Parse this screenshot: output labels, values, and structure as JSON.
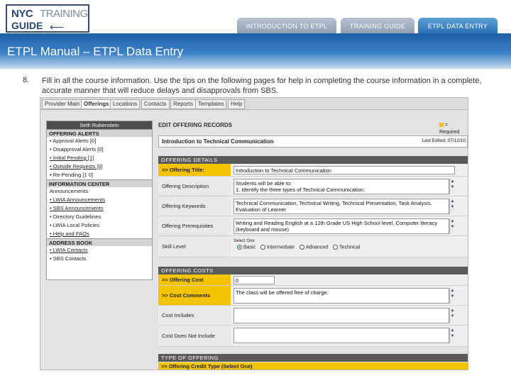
{
  "logo": {
    "nyc": "NYC",
    "training": "TRAINING",
    "guide": "GUIDE"
  },
  "nav": [
    {
      "label": "INTRODUCTION TO ETPL"
    },
    {
      "label": "TRAINING GUIDE"
    },
    {
      "label": "ETPL DATA ENTRY"
    }
  ],
  "page_title": "ETPL Manual – ETPL Data Entry",
  "step": {
    "number": "8.",
    "text": "Fill in all the course information. Use the tips on the following pages for help in completing the course information in a complete, accurate manner that will reduce delays and disapprovals from SBS."
  },
  "screenshot": {
    "tabs": [
      "Provider Main",
      "Offerings",
      "Locations",
      "Contacts",
      "Reports",
      "Templates",
      "Help"
    ],
    "user_name": "Seth Rubenstein",
    "sidebar": {
      "offering_alerts": {
        "heading": "OFFERING ALERTS",
        "items": [
          "• Approval Alerts [0]",
          "• Disapproval Alerts [0]",
          "• Initial Pending [1]",
          "• Outside Requests [0]",
          "• Re-Pending [1 0]"
        ]
      },
      "information_center": {
        "heading": "INFORMATION CENTER",
        "items": [
          "Announcements",
          "• LWIA Announcements",
          "• SBS Announcements",
          "• Directory Guidelines",
          "• LWIA Local Policies",
          "• Help and FAQs"
        ]
      },
      "address_book": {
        "heading": "ADDRESS BOOK",
        "items": [
          "• LWIA Contacts",
          "• SBS Contacts"
        ]
      }
    },
    "edit_heading": "EDIT OFFERING RECORDS",
    "required_label": "= Required field",
    "course_name": "Introduction to Technical Communication",
    "last_edited": "Last Edited: 07/12/10",
    "offering_details": {
      "heading": "OFFERING DETAILS",
      "title_label": ">> Offering Title:",
      "title_value": "Introduction to Technical Communication",
      "description_label": "Offering Description",
      "description_value": "Students will be able to:\n1.          Identify the three types of Technical Communication:",
      "keywords_label": "Offering Keywords",
      "keywords_value": "Technical Communication, Technical Writing, Technical Presentation, Task Analysis, Evaluation of Learner",
      "prerequisites_label": "Offering Prerequisites",
      "prerequisites_value": "Writing and Reading English at a 12th Grade US High School level, Computer literacy (keyboard and mouse)",
      "skill_label": "Skill Level",
      "skill_hint": "Select One",
      "skill_options": [
        "Basic",
        "Intermediate",
        "Advanced",
        "Technical"
      ],
      "skill_selected": "Basic"
    },
    "offering_costs": {
      "heading": "OFFERING COSTS",
      "cost_label": ">> Offering Cost",
      "cost_value": "0",
      "comments_label": ">> Cost Comments",
      "comments_value": "The class will be offered free of charge.",
      "includes_label": "Cost Includes",
      "not_include_label": "Cost Does Not Include"
    },
    "type_of_offering": {
      "heading": "TYPE OF OFFERING",
      "credit_label": ">> Offering Credit Type (Select One)"
    }
  }
}
